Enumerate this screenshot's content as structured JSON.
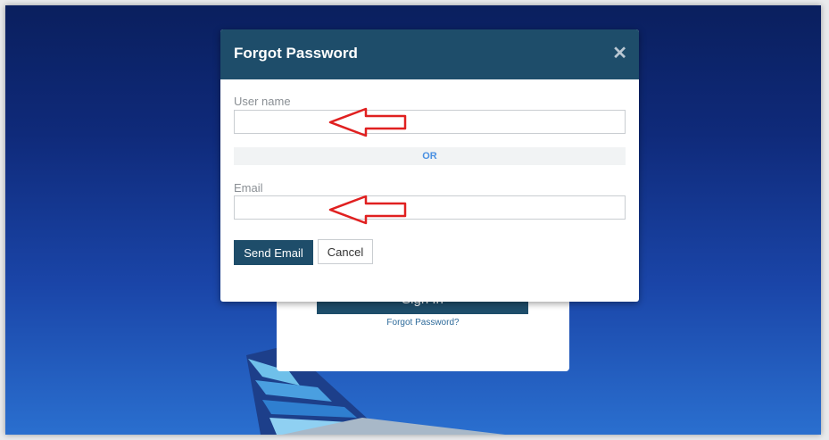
{
  "login": {
    "sign_in_label": "Sign In",
    "forgot_link": "Forgot Password?"
  },
  "modal": {
    "title": "Forgot Password",
    "close_glyph": "✕",
    "username_label": "User name",
    "username_value": "",
    "or_label": "OR",
    "email_label": "Email",
    "email_value": "",
    "send_label": "Send Email",
    "cancel_label": "Cancel"
  },
  "annotations": {
    "arrow_color": "#e02020"
  },
  "colors": {
    "header": "#1e4d6a",
    "or_text": "#4a90e2"
  }
}
